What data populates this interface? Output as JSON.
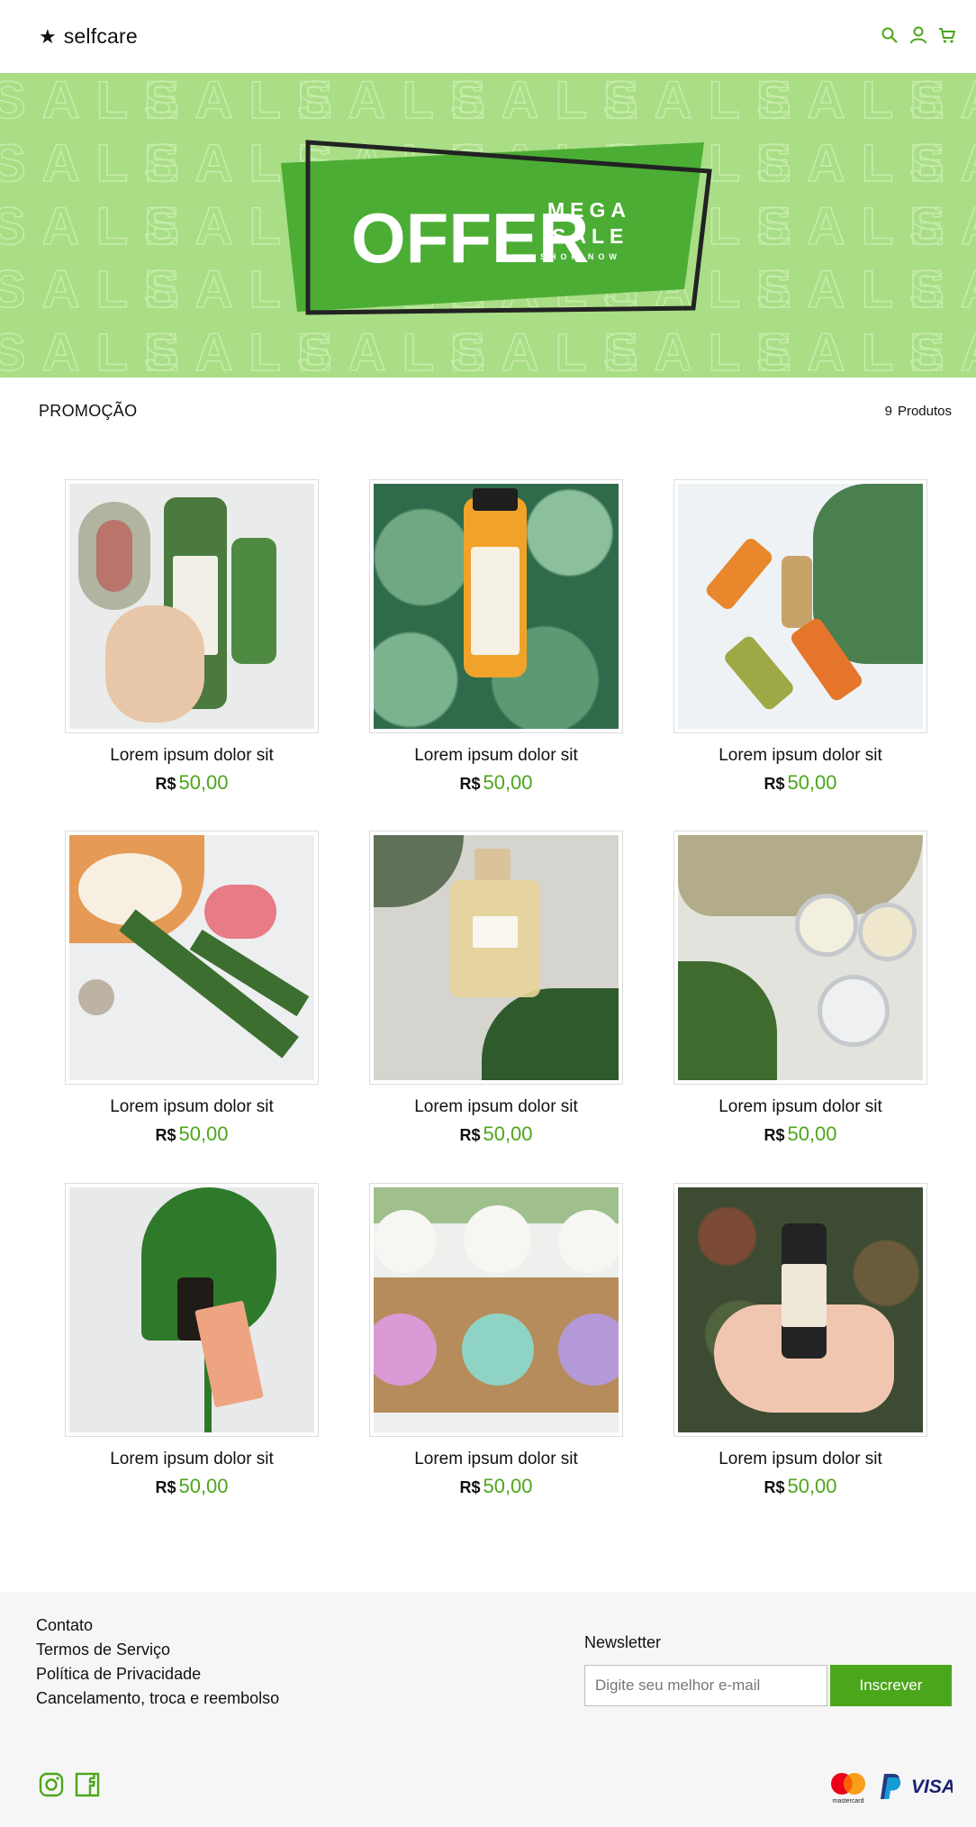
{
  "header": {
    "brand": "selfcare",
    "icons": [
      "star-icon",
      "search-icon",
      "user-icon",
      "cart-icon"
    ]
  },
  "banner": {
    "offer": "OFFER",
    "mega": "MEGA",
    "sale": "SALE",
    "shop_now": "SHOP NOW",
    "pattern_text": "SALE"
  },
  "section": {
    "title": "PROMOÇÃO",
    "count_number": "9",
    "count_label": "Produtos"
  },
  "products": [
    {
      "name": "Lorem ipsum dolor sit",
      "currency": "R$",
      "price": "50,00"
    },
    {
      "name": "Lorem ipsum dolor sit",
      "currency": "R$",
      "price": "50,00"
    },
    {
      "name": "Lorem ipsum dolor sit",
      "currency": "R$",
      "price": "50,00"
    },
    {
      "name": "Lorem ipsum dolor sit",
      "currency": "R$",
      "price": "50,00"
    },
    {
      "name": "Lorem ipsum dolor sit",
      "currency": "R$",
      "price": "50,00"
    },
    {
      "name": "Lorem ipsum dolor sit",
      "currency": "R$",
      "price": "50,00"
    },
    {
      "name": "Lorem ipsum dolor sit",
      "currency": "R$",
      "price": "50,00"
    },
    {
      "name": "Lorem ipsum dolor sit",
      "currency": "R$",
      "price": "50,00"
    },
    {
      "name": "Lorem ipsum dolor sit",
      "currency": "R$",
      "price": "50,00"
    }
  ],
  "footer": {
    "links": [
      "Contato",
      "Termos de Serviço",
      "Política de Privacidade",
      "Cancelamento, troca e reembolso"
    ],
    "newsletter_title": "Newsletter",
    "newsletter_placeholder": "Digite seu melhor e-mail",
    "newsletter_button": "Inscrever",
    "social_icons": [
      "instagram-icon",
      "facebook-icon"
    ],
    "payment_icons": [
      "mastercard-icon",
      "paypal-icon",
      "visa-icon"
    ],
    "mastercard_label": "mastercard",
    "visa_label": "VISA"
  },
  "colors": {
    "accent": "#4ca61b",
    "banner_bg": "#a9dd86",
    "offer_green": "#4cad35"
  }
}
